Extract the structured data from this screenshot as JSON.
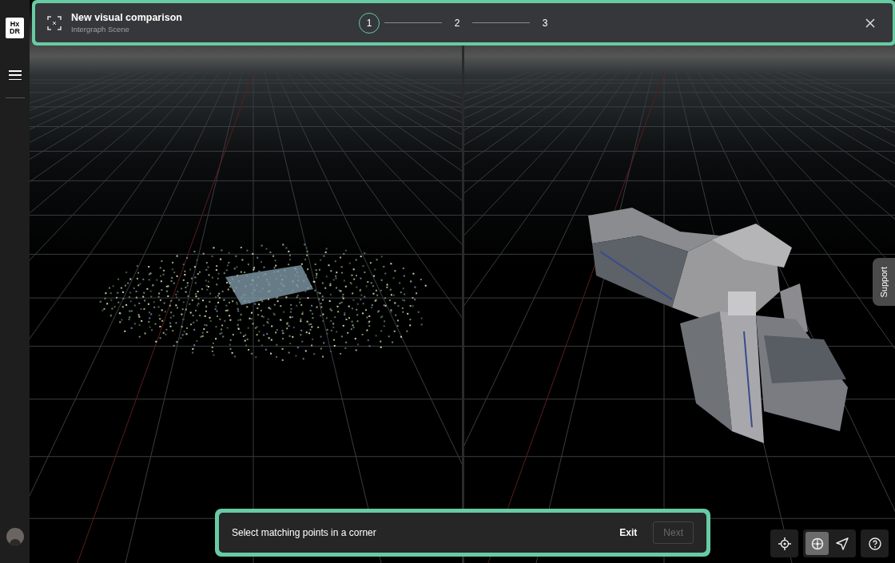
{
  "sidebar": {
    "logo_lines": [
      "Hx",
      "DR"
    ]
  },
  "wizard": {
    "title": "New visual comparison",
    "subtitle": "Intergraph Scene",
    "steps": [
      {
        "label": "1",
        "selected": true
      },
      {
        "label": "2",
        "selected": false
      },
      {
        "label": "3",
        "selected": false
      }
    ]
  },
  "instruction_bar": {
    "text": "Select matching points in a corner",
    "buttons": [
      {
        "label": "Exit",
        "disabled": false
      },
      {
        "label": "Next",
        "disabled": true
      }
    ]
  },
  "support_tab": {
    "label": "Support"
  },
  "toolbar_groups": [
    [
      {
        "kind": "locate",
        "selected": false
      }
    ],
    [
      {
        "kind": "globe",
        "selected": true
      },
      {
        "kind": "send",
        "selected": false
      }
    ],
    [
      {
        "kind": "help",
        "selected": false
      }
    ]
  ]
}
